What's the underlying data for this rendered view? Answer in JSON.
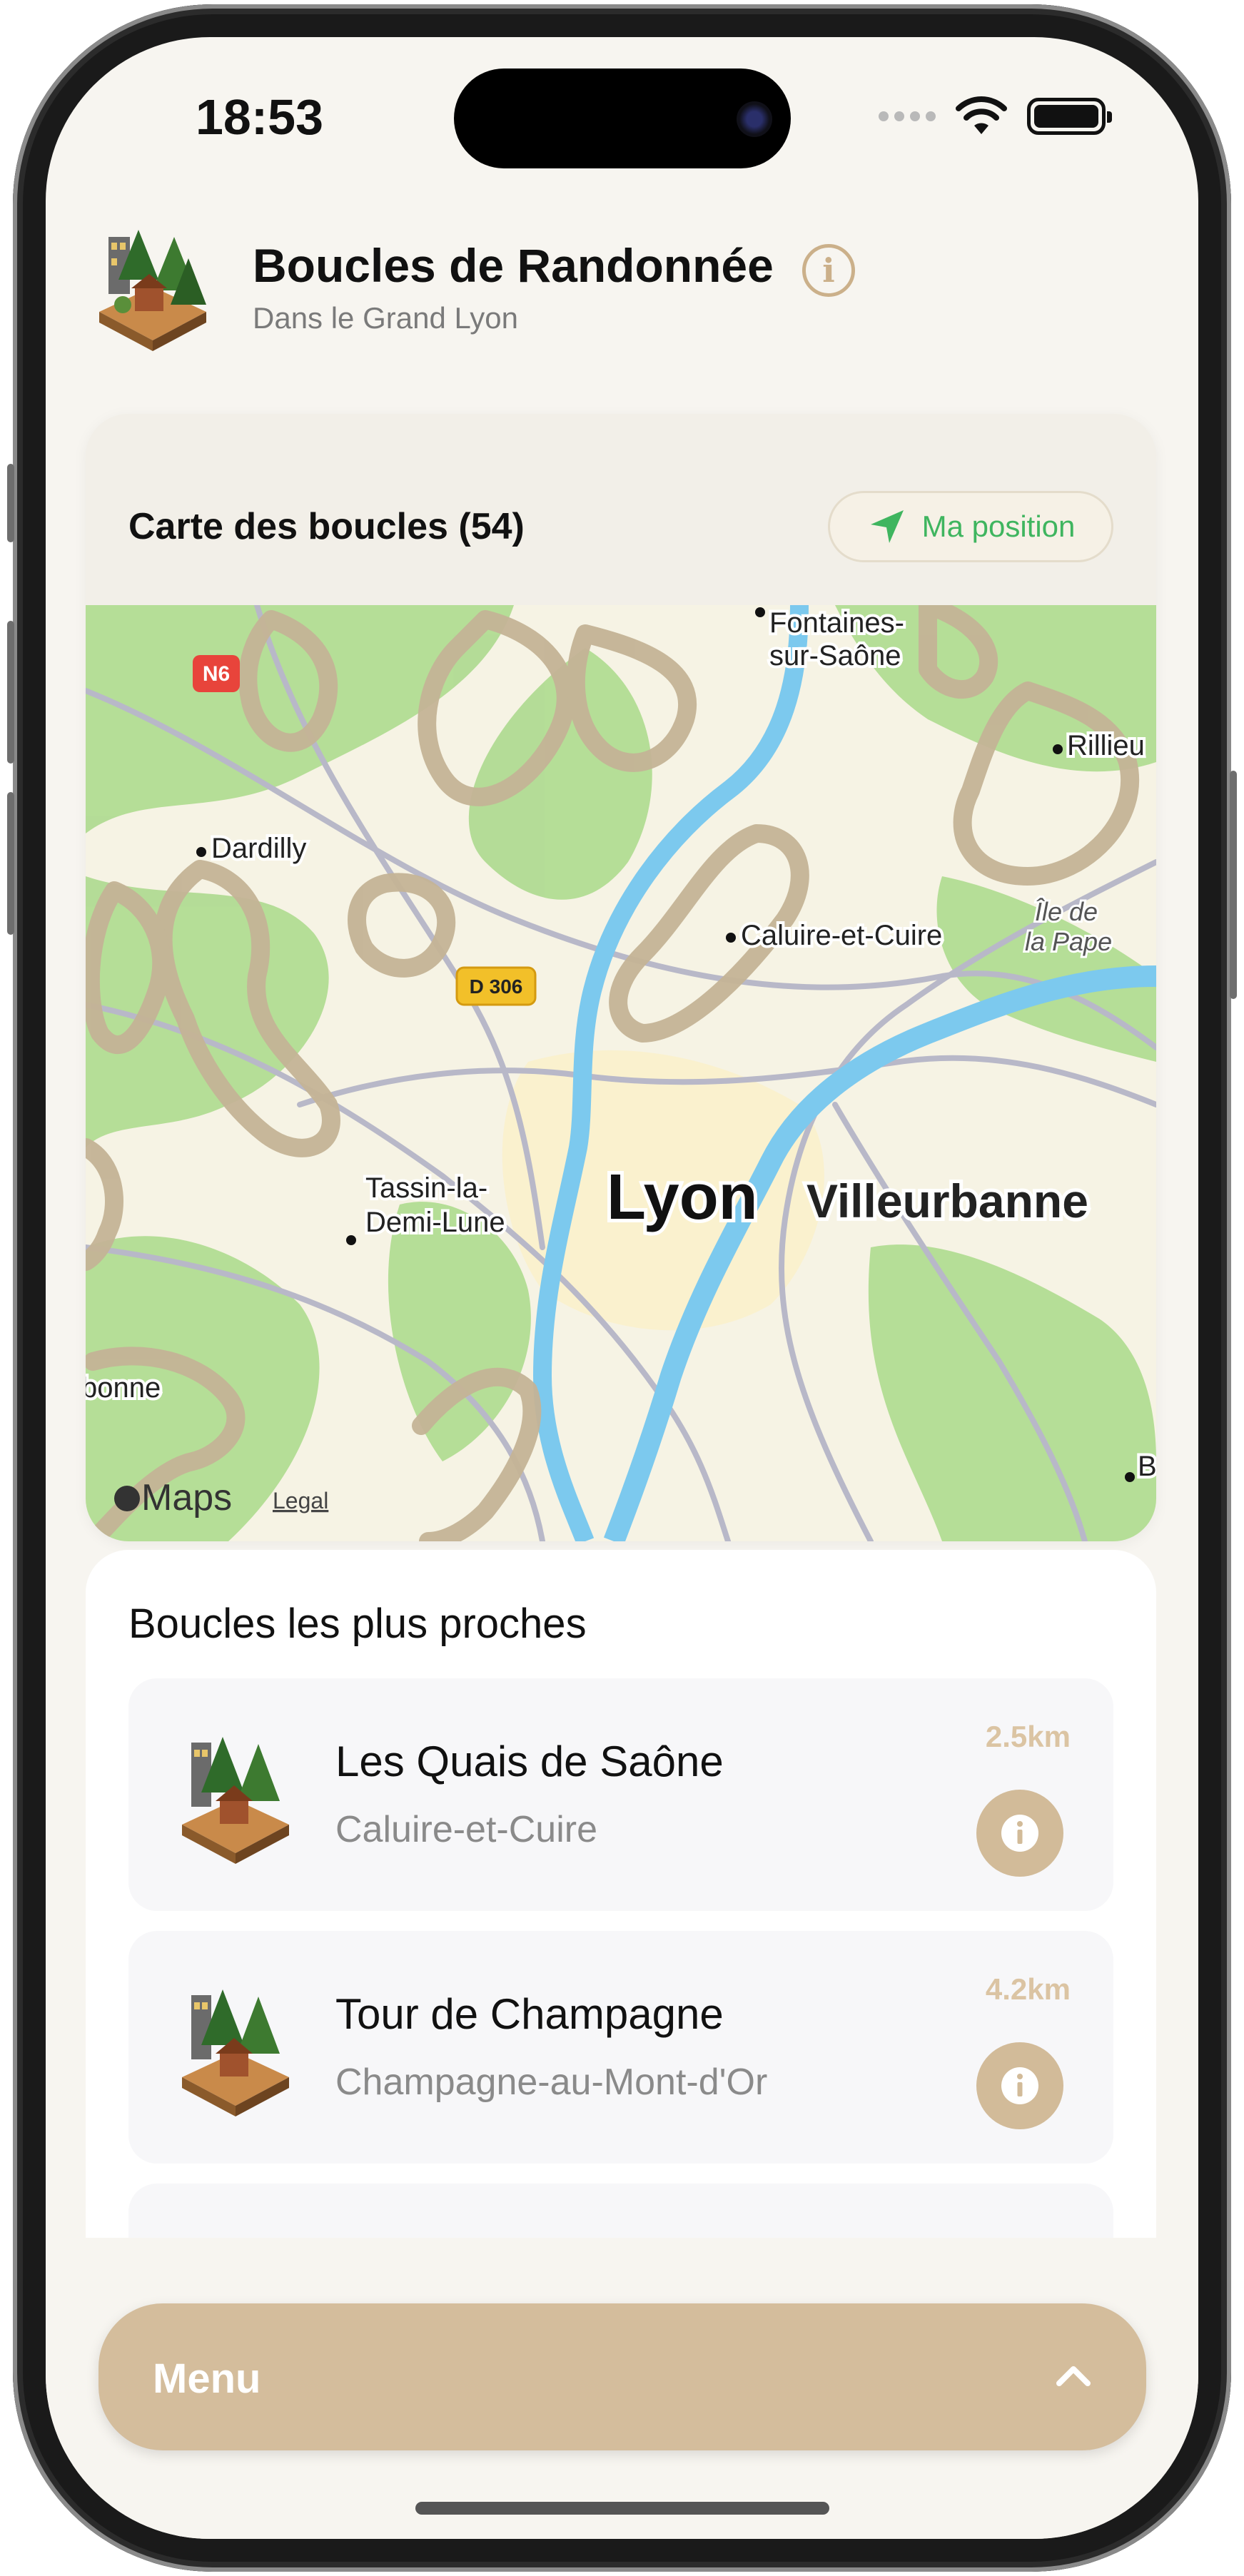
{
  "status_bar": {
    "time": "18:53"
  },
  "header": {
    "title": "Boucles de Randonnée",
    "subtitle": "Dans le Grand Lyon",
    "info_icon": "info-icon"
  },
  "map_card": {
    "title": "Carte des boucles (54)",
    "position_button": "Ma position",
    "map_labels": {
      "fontaines_1": "Fontaines-",
      "fontaines_2": "sur-Saône",
      "rillieux": "Rillieu",
      "dardilly": "Dardilly",
      "caluire": "Caluire-et-Cuire",
      "ile_1": "Île de",
      "ile_2": "la Pape",
      "tassin_1": "Tassin-la-",
      "tassin_2": "Demi-Lune",
      "lyon": "Lyon",
      "villeurbanne": "Villeurbanne",
      "bonne": "bonne",
      "b": "B",
      "n6": "N6",
      "d306": "D 306",
      "maps": "Maps",
      "legal": "Legal"
    }
  },
  "nearby": {
    "title": "Boucles les plus proches",
    "items": [
      {
        "name": "Les Quais de Saône",
        "city": "Caluire-et-Cuire",
        "distance": "2.5km"
      },
      {
        "name": "Tour de Champagne",
        "city": "Champagne-au-Mont-d'Or",
        "distance": "4.2km"
      }
    ]
  },
  "menu": {
    "label": "Menu"
  },
  "colors": {
    "accent": "#d4bd9c",
    "background": "#f7f5f0",
    "location_green": "#3fb55f",
    "trail": "#c4b396"
  }
}
